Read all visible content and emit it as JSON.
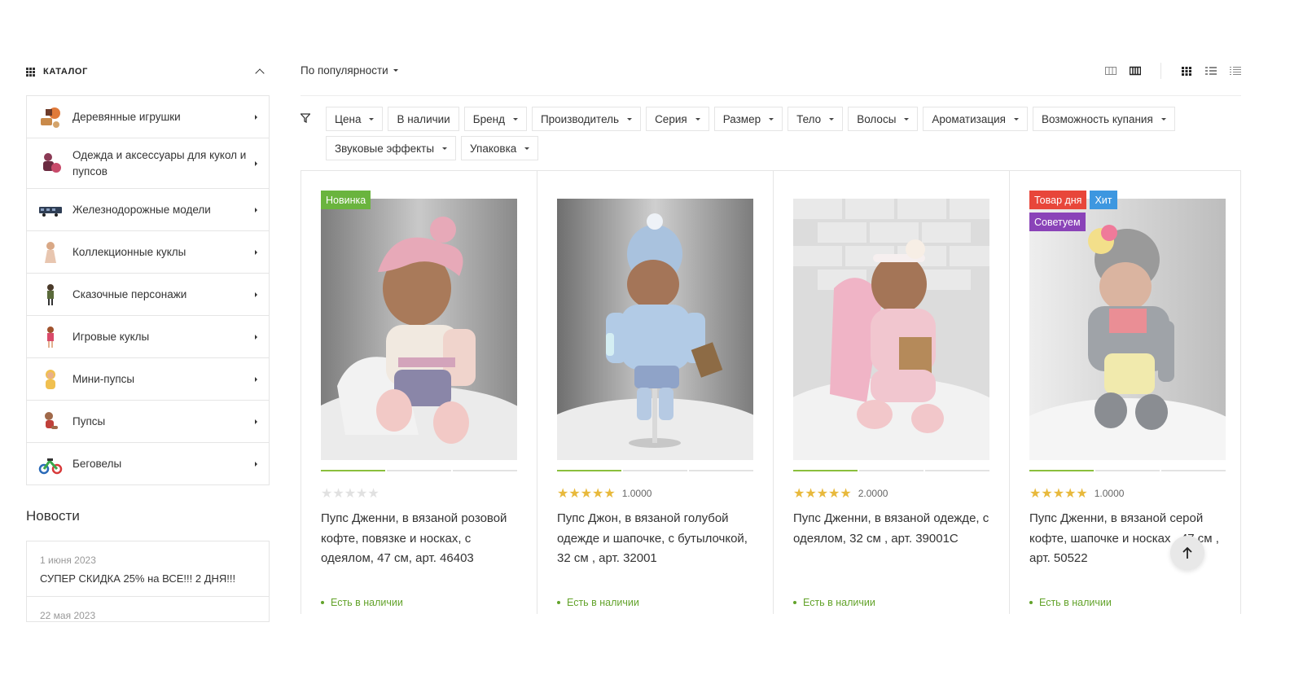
{
  "sidebar": {
    "catalog_title": "КАТАЛОГ",
    "items": [
      {
        "label": "Деревянные игрушки",
        "icon": "wooden-toys-icon"
      },
      {
        "label": "Одежда и аксессуары для кукол и пупсов",
        "icon": "doll-clothes-icon"
      },
      {
        "label": "Железнодорожные модели",
        "icon": "train-icon"
      },
      {
        "label": "Коллекционные куклы",
        "icon": "collectible-doll-icon"
      },
      {
        "label": "Сказочные персонажи",
        "icon": "fairy-character-icon"
      },
      {
        "label": "Игровые куклы",
        "icon": "play-doll-icon"
      },
      {
        "label": "Мини-пупсы",
        "icon": "mini-baby-icon"
      },
      {
        "label": "Пупсы",
        "icon": "baby-doll-icon"
      },
      {
        "label": "Беговелы",
        "icon": "balance-bike-icon"
      }
    ],
    "news_title": "Новости",
    "news": [
      {
        "date": "1 июня 2023",
        "text": "СУПЕР СКИДКА 25% на ВСЕ!!! 2 ДНЯ!!!"
      },
      {
        "date": "22 мая 2023",
        "text": ""
      }
    ]
  },
  "sort": {
    "label": "По популярности"
  },
  "filters": [
    "Цена",
    "В наличии",
    "Бренд",
    "Производитель",
    "Серия",
    "Размер",
    "Тело",
    "Волосы",
    "Ароматизация",
    "Возможность купания",
    "Звуковые эффекты",
    "Упаковка"
  ],
  "products": [
    {
      "badges": [
        {
          "label": "Новинка",
          "color": "#6ab43e"
        }
      ],
      "rating_stars": 0,
      "rating": "",
      "title": "Пупс Дженни, в вязаной розовой кофте, повязке и носках, с одеялом, 47 см, арт. 46403",
      "stock": "Есть в наличии"
    },
    {
      "badges": [],
      "rating_stars": 5,
      "rating": "1.0000",
      "title": "Пупс Джон, в вязаной голубой одежде и шапочке, с бутылочкой, 32 см , арт. 32001",
      "stock": "Есть в наличии"
    },
    {
      "badges": [],
      "rating_stars": 5,
      "rating": "2.0000",
      "title": "Пупс Дженни, в вязаной одежде, с одеялом, 32 см , арт. 39001С",
      "stock": "Есть в наличии"
    },
    {
      "badges": [
        {
          "label": "Товар дня",
          "color": "#e8463a"
        },
        {
          "label": "Хит",
          "color": "#3d97e0"
        },
        {
          "label": "Советуем",
          "color": "#8a43b8"
        }
      ],
      "rating_stars": 5,
      "rating": "1.0000",
      "title": "Пупс Дженни, в вязаной серой кофте, шапочке и носках , 47 см , арт. 50522",
      "stock": "Есть в наличии"
    }
  ],
  "stars_full": "★★★★★",
  "colors": {
    "accent_green": "#6ab43e",
    "stock_green": "#63a32b",
    "star": "#e8b93c"
  }
}
